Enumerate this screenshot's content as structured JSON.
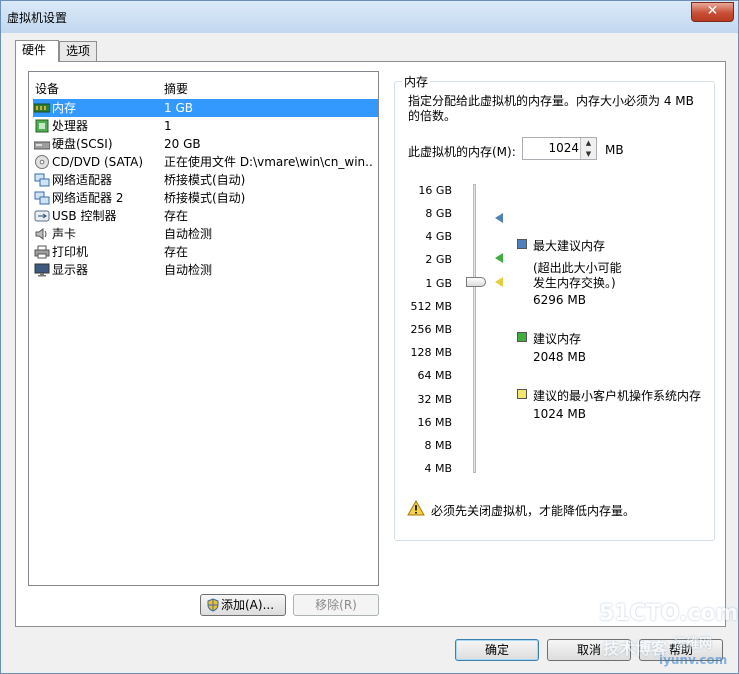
{
  "window": {
    "title": "虚拟机设置",
    "close_glyph": "✕"
  },
  "tabs": [
    {
      "label": "硬件"
    },
    {
      "label": "选项"
    }
  ],
  "device_list": {
    "headers": {
      "device": "设备",
      "summary": "摘要"
    },
    "rows": [
      {
        "name": "内存",
        "summary": "1 GB",
        "icon": "memory-icon"
      },
      {
        "name": "处理器",
        "summary": "1",
        "icon": "cpu-icon"
      },
      {
        "name": "硬盘(SCSI)",
        "summary": "20 GB",
        "icon": "harddisk-icon"
      },
      {
        "name": "CD/DVD (SATA)",
        "summary": "正在使用文件 D:\\vmare\\win\\cn_win...",
        "icon": "cd-icon"
      },
      {
        "name": "网络适配器",
        "summary": "桥接模式(自动)",
        "icon": "network-icon"
      },
      {
        "name": "网络适配器 2",
        "summary": "桥接模式(自动)",
        "icon": "network-icon"
      },
      {
        "name": "USB 控制器",
        "summary": "存在",
        "icon": "usb-icon"
      },
      {
        "name": "声卡",
        "summary": "自动检测",
        "icon": "speaker-icon"
      },
      {
        "name": "打印机",
        "summary": "存在",
        "icon": "printer-icon"
      },
      {
        "name": "显示器",
        "summary": "自动检测",
        "icon": "monitor-icon"
      }
    ],
    "selected_index": 0
  },
  "buttons": {
    "add": "添加(A)...",
    "remove": "移除(R)",
    "ok": "确定",
    "cancel": "取消",
    "help": "帮助"
  },
  "memory": {
    "group_title": "内存",
    "description": "指定分配给此虚拟机的内存量。内存大小必须为 4 MB 的倍数。",
    "field_label": "此虚拟机的内存(M):",
    "value": "1024",
    "unit": "MB",
    "scale_ticks": [
      "16 GB",
      "8 GB",
      "4 GB",
      "2 GB",
      "1 GB",
      "512 MB",
      "256 MB",
      "128 MB",
      "64 MB",
      "32 MB",
      "16 MB",
      "8 MB",
      "4 MB"
    ],
    "current_setting_mb": 1024,
    "legend": {
      "max": {
        "title": "最大建议内存",
        "note_line1": "(超出此大小可能",
        "note_line2": "发生内存交换。)",
        "value": "6296 MB",
        "color": "#4f81bd"
      },
      "recommended": {
        "title": "建议内存",
        "value": "2048 MB",
        "color": "#3fae3f"
      },
      "min": {
        "title": "建议的最小客户机操作系统内存",
        "value": "1024 MB",
        "color": "#f2e66b"
      }
    },
    "warning": "必须先关闭虚拟机，才能降低内存量。"
  },
  "watermark": {
    "site": "51CTO.com",
    "line2": "技术博客",
    "line3": "运维网",
    "line4": "iyunv.com"
  }
}
